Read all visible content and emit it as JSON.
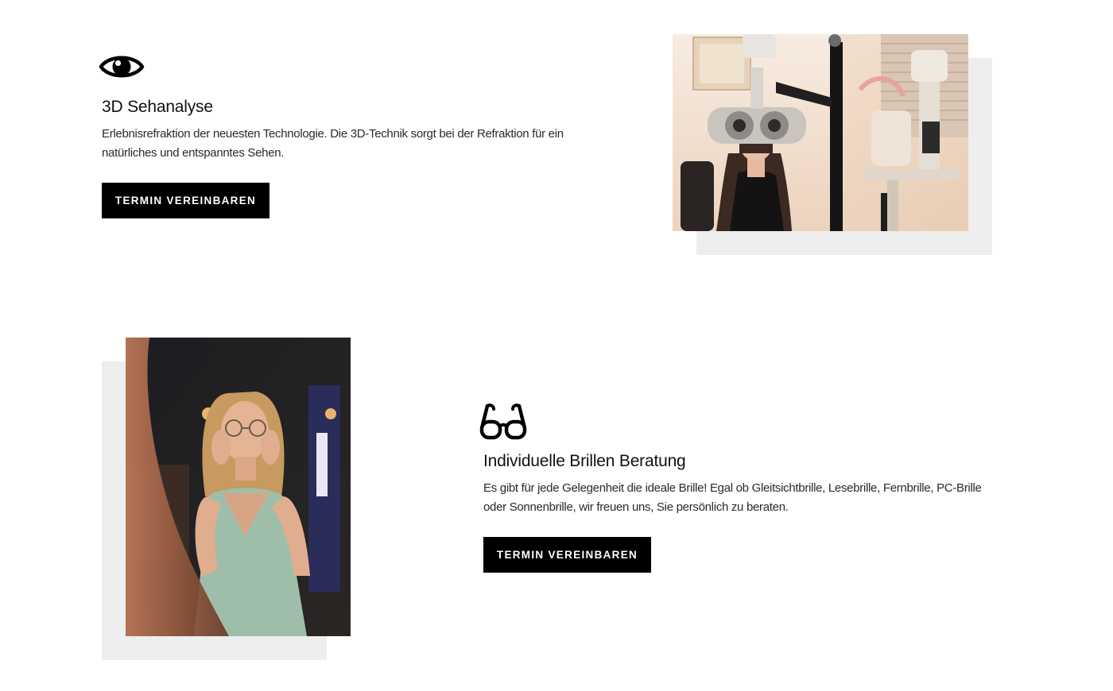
{
  "services": [
    {
      "icon": "eye-icon",
      "title": "3D Sehanalyse",
      "description": "Erlebnisrefraktion der neuesten Technologie. Die 3D-Technik sorgt bei der Refraktion für ein natürliches und entspanntes Sehen.",
      "button_label": "TERMIN VEREINBAREN",
      "image": "photo of a woman looking into a phoropter at an eye examination device"
    },
    {
      "icon": "glasses-icon",
      "title": "Individuelle Brillen Beratung",
      "description": "Es gibt für jede Gelegenheit die ideale Brille! Egal ob Gleitsichtbrille, Lesebrille, Fernbrille, PC-Brille oder Sonnenbrille, wir freuen uns, Sie persönlich zu beraten.",
      "button_label": "TERMIN VEREINBAREN",
      "image": "photo of a blonde woman trying on round glasses in front of a mirror"
    }
  ],
  "colors": {
    "background": "#ffffff",
    "button": "#000000",
    "button_text": "#ffffff",
    "image_backdrop": "#eeeeee",
    "text": "#111111"
  }
}
